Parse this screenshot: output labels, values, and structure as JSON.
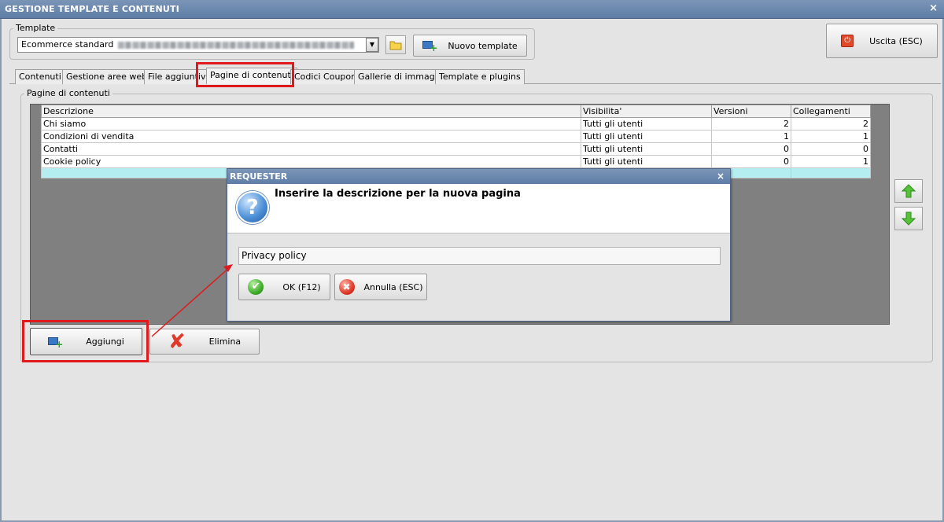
{
  "window": {
    "title": "GESTIONE TEMPLATE E CONTENUTI",
    "close_glyph": "×"
  },
  "template": {
    "legend": "Template",
    "selected": "Ecommerce standard",
    "combo_arrow": "▼",
    "new_button": "Nuovo template"
  },
  "exit_button": "Uscita (ESC)",
  "tabs": [
    {
      "label": "Contenuti"
    },
    {
      "label": "Gestione aree web"
    },
    {
      "label": "File aggiuntivi"
    },
    {
      "label": "Pagine di contenuti"
    },
    {
      "label": "Codici Coupon"
    },
    {
      "label": "Gallerie di immagini"
    },
    {
      "label": "Template e plugins"
    }
  ],
  "content": {
    "legend": "Pagine di contenuti",
    "columns": [
      "Descrizione",
      "Visibilita'",
      "Versioni",
      "Collegamenti"
    ],
    "rows": [
      {
        "descrizione": "Chi siamo",
        "visibilita": "Tutti gli utenti",
        "versioni": "2",
        "collegamenti": "2"
      },
      {
        "descrizione": "Condizioni di vendita",
        "visibilita": "Tutti gli utenti",
        "versioni": "1",
        "collegamenti": "1"
      },
      {
        "descrizione": "Contatti",
        "visibilita": "Tutti gli utenti",
        "versioni": "0",
        "collegamenti": "0"
      },
      {
        "descrizione": "Cookie policy",
        "visibilita": "Tutti gli utenti",
        "versioni": "0",
        "collegamenti": "1"
      }
    ],
    "add_button": "Aggiungi",
    "delete_button": "Elimina"
  },
  "requester": {
    "title": "REQUESTER",
    "message": "Inserire la descrizione per la nuova pagina",
    "input_value": "Privacy policy",
    "ok_button": "OK (F12)",
    "cancel_button": "Annulla (ESC)"
  },
  "colors": {
    "titlebar": "#6a88b0",
    "highlight": "#e0191c",
    "new_row": "#b4eef0",
    "grid_bg": "#808080"
  }
}
